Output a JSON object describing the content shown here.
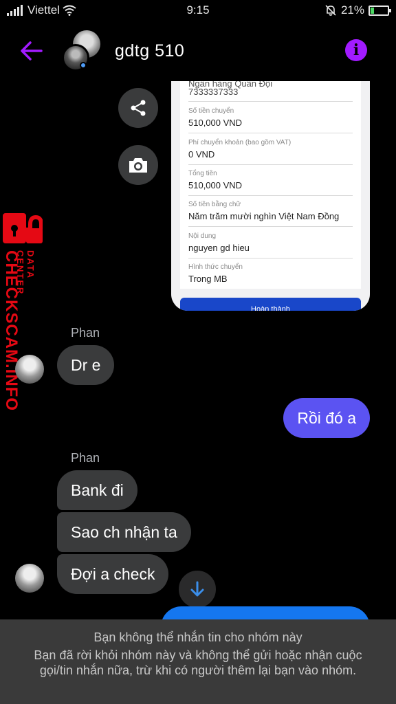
{
  "status_bar": {
    "carrier": "Viettel",
    "time": "9:15",
    "battery": "21%",
    "battery_level": 0.21
  },
  "header": {
    "title": "gdtg 510",
    "back_icon": "arrow-left-icon",
    "info_icon": "info-icon",
    "accent_color": "#a21bff"
  },
  "receipt": {
    "partial_top": "Ngân hàng Quân Đội",
    "account": "7333337333",
    "rows": [
      {
        "label": "Số tiền chuyển",
        "value": "510,000 VND"
      },
      {
        "label": "Phí chuyển khoản (bao gồm VAT)",
        "value": "0 VND"
      },
      {
        "label": "Tổng tiền",
        "value": "510,000 VND"
      },
      {
        "label": "Số tiền bằng chữ",
        "value": "Năm trăm mười nghìn Việt Nam Đồng"
      },
      {
        "label": "Nội dung",
        "value": "nguyen gd hieu"
      },
      {
        "label": "Hình thức chuyển",
        "value": "Trong MB"
      }
    ],
    "done_label": "Hoàn thành"
  },
  "watermark": {
    "main": "CHECKSCAM.INFO",
    "sub": "DATA CENTER",
    "color": "#e50914"
  },
  "messages": {
    "group1_sender": "Phan",
    "group1": [
      "Dr e"
    ],
    "outgoing": "Rồi đó a",
    "group2_sender": "Phan",
    "group2": [
      "Bank đi",
      "Sao ch nhận ta",
      "Đợi a check"
    ]
  },
  "footer": {
    "title": "Bạn không thể nhắn tin cho nhóm này",
    "body": "Bạn đã rời khỏi nhóm này và không thể gửi hoặc nhận cuộc gọi/tin nhắn nữa, trừ khi có người thêm lại bạn vào nhóm."
  }
}
